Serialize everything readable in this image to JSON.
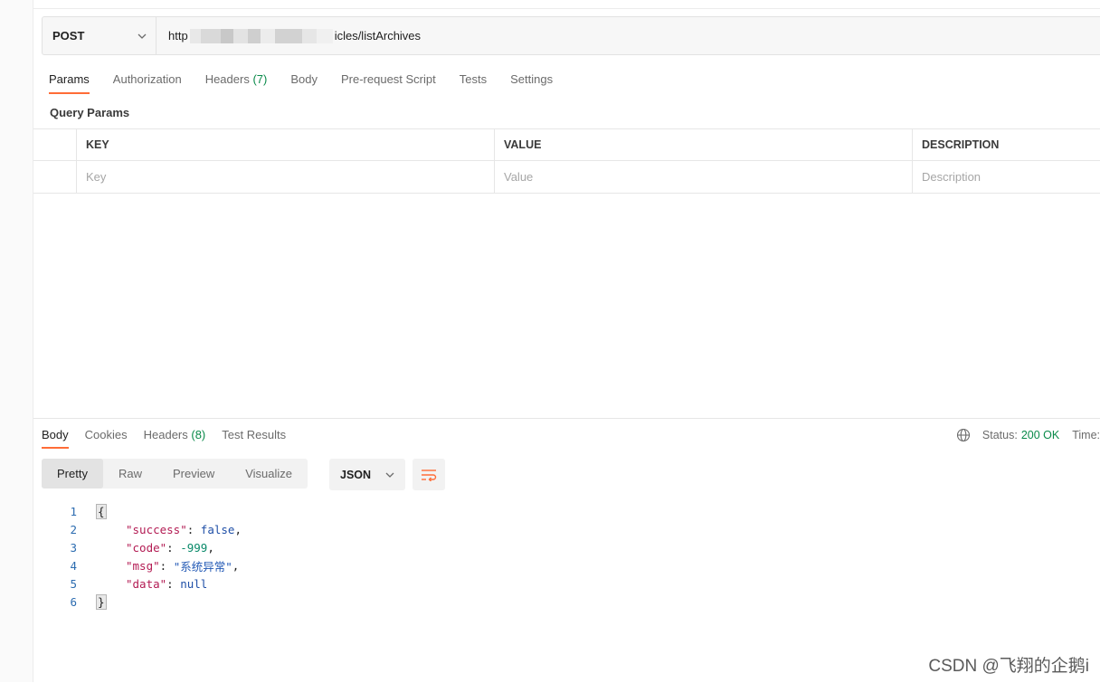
{
  "request": {
    "method": "POST",
    "url_prefix": "http",
    "url_suffix": "icles/listArchives",
    "tabs": [
      {
        "label": "Params",
        "count": ""
      },
      {
        "label": "Authorization",
        "count": ""
      },
      {
        "label": "Headers",
        "count": "(7)"
      },
      {
        "label": "Body",
        "count": ""
      },
      {
        "label": "Pre-request Script",
        "count": ""
      },
      {
        "label": "Tests",
        "count": ""
      },
      {
        "label": "Settings",
        "count": ""
      }
    ],
    "query_params_title": "Query Params",
    "table": {
      "headers": [
        "KEY",
        "VALUE",
        "DESCRIPTION"
      ],
      "placeholders": [
        "Key",
        "Value",
        "Description"
      ]
    }
  },
  "response": {
    "tabs": [
      {
        "label": "Body",
        "count": ""
      },
      {
        "label": "Cookies",
        "count": ""
      },
      {
        "label": "Headers",
        "count": "(8)"
      },
      {
        "label": "Test Results",
        "count": ""
      }
    ],
    "status_label": "Status:",
    "status_value": "200 OK",
    "time_label": "Time:",
    "view_modes": [
      "Pretty",
      "Raw",
      "Preview",
      "Visualize"
    ],
    "format": "JSON",
    "lines": {
      "n1": "1",
      "n2": "2",
      "n3": "3",
      "n4": "4",
      "n5": "5",
      "n6": "6",
      "open_brace": "{",
      "close_brace": "}",
      "k_success": "\"success\"",
      "v_success": "false",
      "k_code": "\"code\"",
      "v_code": "-999",
      "k_msg": "\"msg\"",
      "v_msg": "\"系统异常\"",
      "k_data": "\"data\"",
      "v_data": "null"
    },
    "colors": {
      "accent": "#ff6c37",
      "ok": "#0a8a4a"
    }
  },
  "watermark": "CSDN @飞翔的企鹅i"
}
